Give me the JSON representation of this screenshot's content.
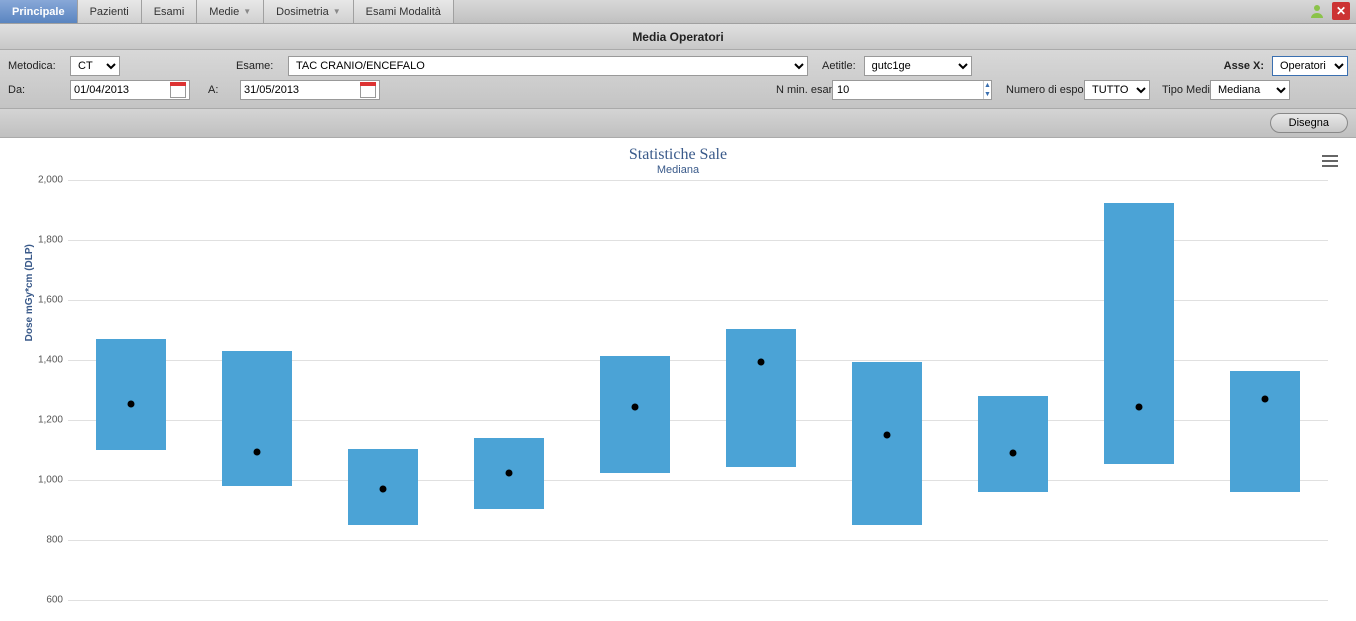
{
  "nav": {
    "tabs": [
      {
        "label": "Principale",
        "active": true
      },
      {
        "label": "Pazienti"
      },
      {
        "label": "Esami"
      },
      {
        "label": "Medie",
        "caret": true
      },
      {
        "label": "Dosimetria",
        "caret": true
      },
      {
        "label": "Esami Modalità"
      }
    ]
  },
  "page_title": "Media Operatori",
  "filters": {
    "metodica_label": "Metodica:",
    "metodica_value": "CT",
    "esame_label": "Esame:",
    "esame_value": "TAC CRANIO/ENCEFALO",
    "aetitle_label": "Aetitle:",
    "aetitle_value": "gutc1ge",
    "assex_label": "Asse X:",
    "assex_value": "Operatori",
    "da_label": "Da:",
    "da_value": "01/04/2013",
    "a_label": "A:",
    "a_value": "31/05/2013",
    "nmin_label": "N min. esami :",
    "nmin_value": "10",
    "numesp_label": "Numero di esposizioni:",
    "numesp_value": "TUTTO",
    "tipomedia_label": "Tipo Media:",
    "tipomedia_value": "Mediana"
  },
  "draw_button": "Disegna",
  "chart_data": {
    "type": "bar",
    "title": "Statistiche Sale",
    "subtitle": "Mediana",
    "ylabel": "Dose mGy*cm (DLP)",
    "ylim": [
      600,
      2000
    ],
    "yticks": [
      600,
      800,
      1000,
      1200,
      1400,
      1600,
      1800,
      2000
    ],
    "series": [
      {
        "low": 1100,
        "high": 1470,
        "median": 1255
      },
      {
        "low": 980,
        "high": 1430,
        "median": 1095
      },
      {
        "low": 850,
        "high": 1105,
        "median": 970
      },
      {
        "low": 905,
        "high": 1140,
        "median": 1025
      },
      {
        "low": 1025,
        "high": 1415,
        "median": 1245
      },
      {
        "low": 1045,
        "high": 1505,
        "median": 1395
      },
      {
        "low": 850,
        "high": 1395,
        "median": 1150
      },
      {
        "low": 960,
        "high": 1280,
        "median": 1090
      },
      {
        "low": 1055,
        "high": 1925,
        "median": 1245
      },
      {
        "low": 960,
        "high": 1365,
        "median": 1270
      }
    ]
  }
}
